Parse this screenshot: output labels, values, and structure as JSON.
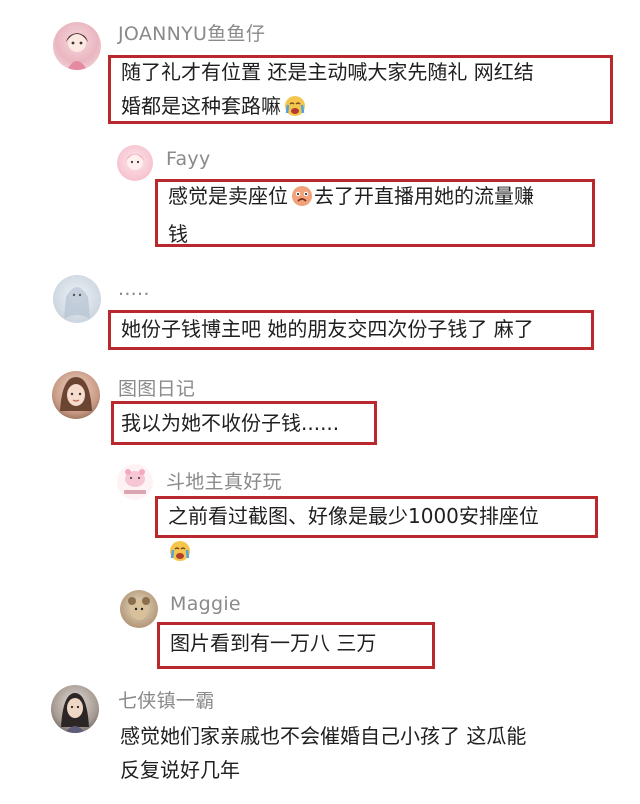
{
  "comments": [
    {
      "user": "JOANNYU鱼鱼仔",
      "lines": [
        "随了礼才有位置 还是主动喊大家先随礼 网红结",
        "婚都是这种套路嘛"
      ],
      "emoji": "crying-face"
    },
    {
      "user": "Fayy",
      "lines": [
        "感觉是卖座位",
        "去了开直播用她的流量赚",
        "钱"
      ],
      "emoji": "sad-face"
    },
    {
      "user": ".....",
      "lines": [
        "她份子钱博主吧 她的朋友交四次份子钱了 麻了"
      ]
    },
    {
      "user": "图图日记",
      "lines": [
        "我以为她不收份子钱......"
      ]
    },
    {
      "user": "斗地主真好玩",
      "lines": [
        "之前看过截图、好像是最少1000安排座位"
      ],
      "emoji": "crying-face"
    },
    {
      "user": "Maggie",
      "lines": [
        "图片看到有一万八 三万"
      ]
    },
    {
      "user": "七侠镇一霸",
      "lines": [
        "感觉她们家亲戚也不会催婚自己小孩了 这瓜能",
        "反复说好几年"
      ]
    }
  ],
  "colors": {
    "highlight": "#b8282d",
    "username": "#8a8a8a",
    "text": "#1f1f1f"
  }
}
